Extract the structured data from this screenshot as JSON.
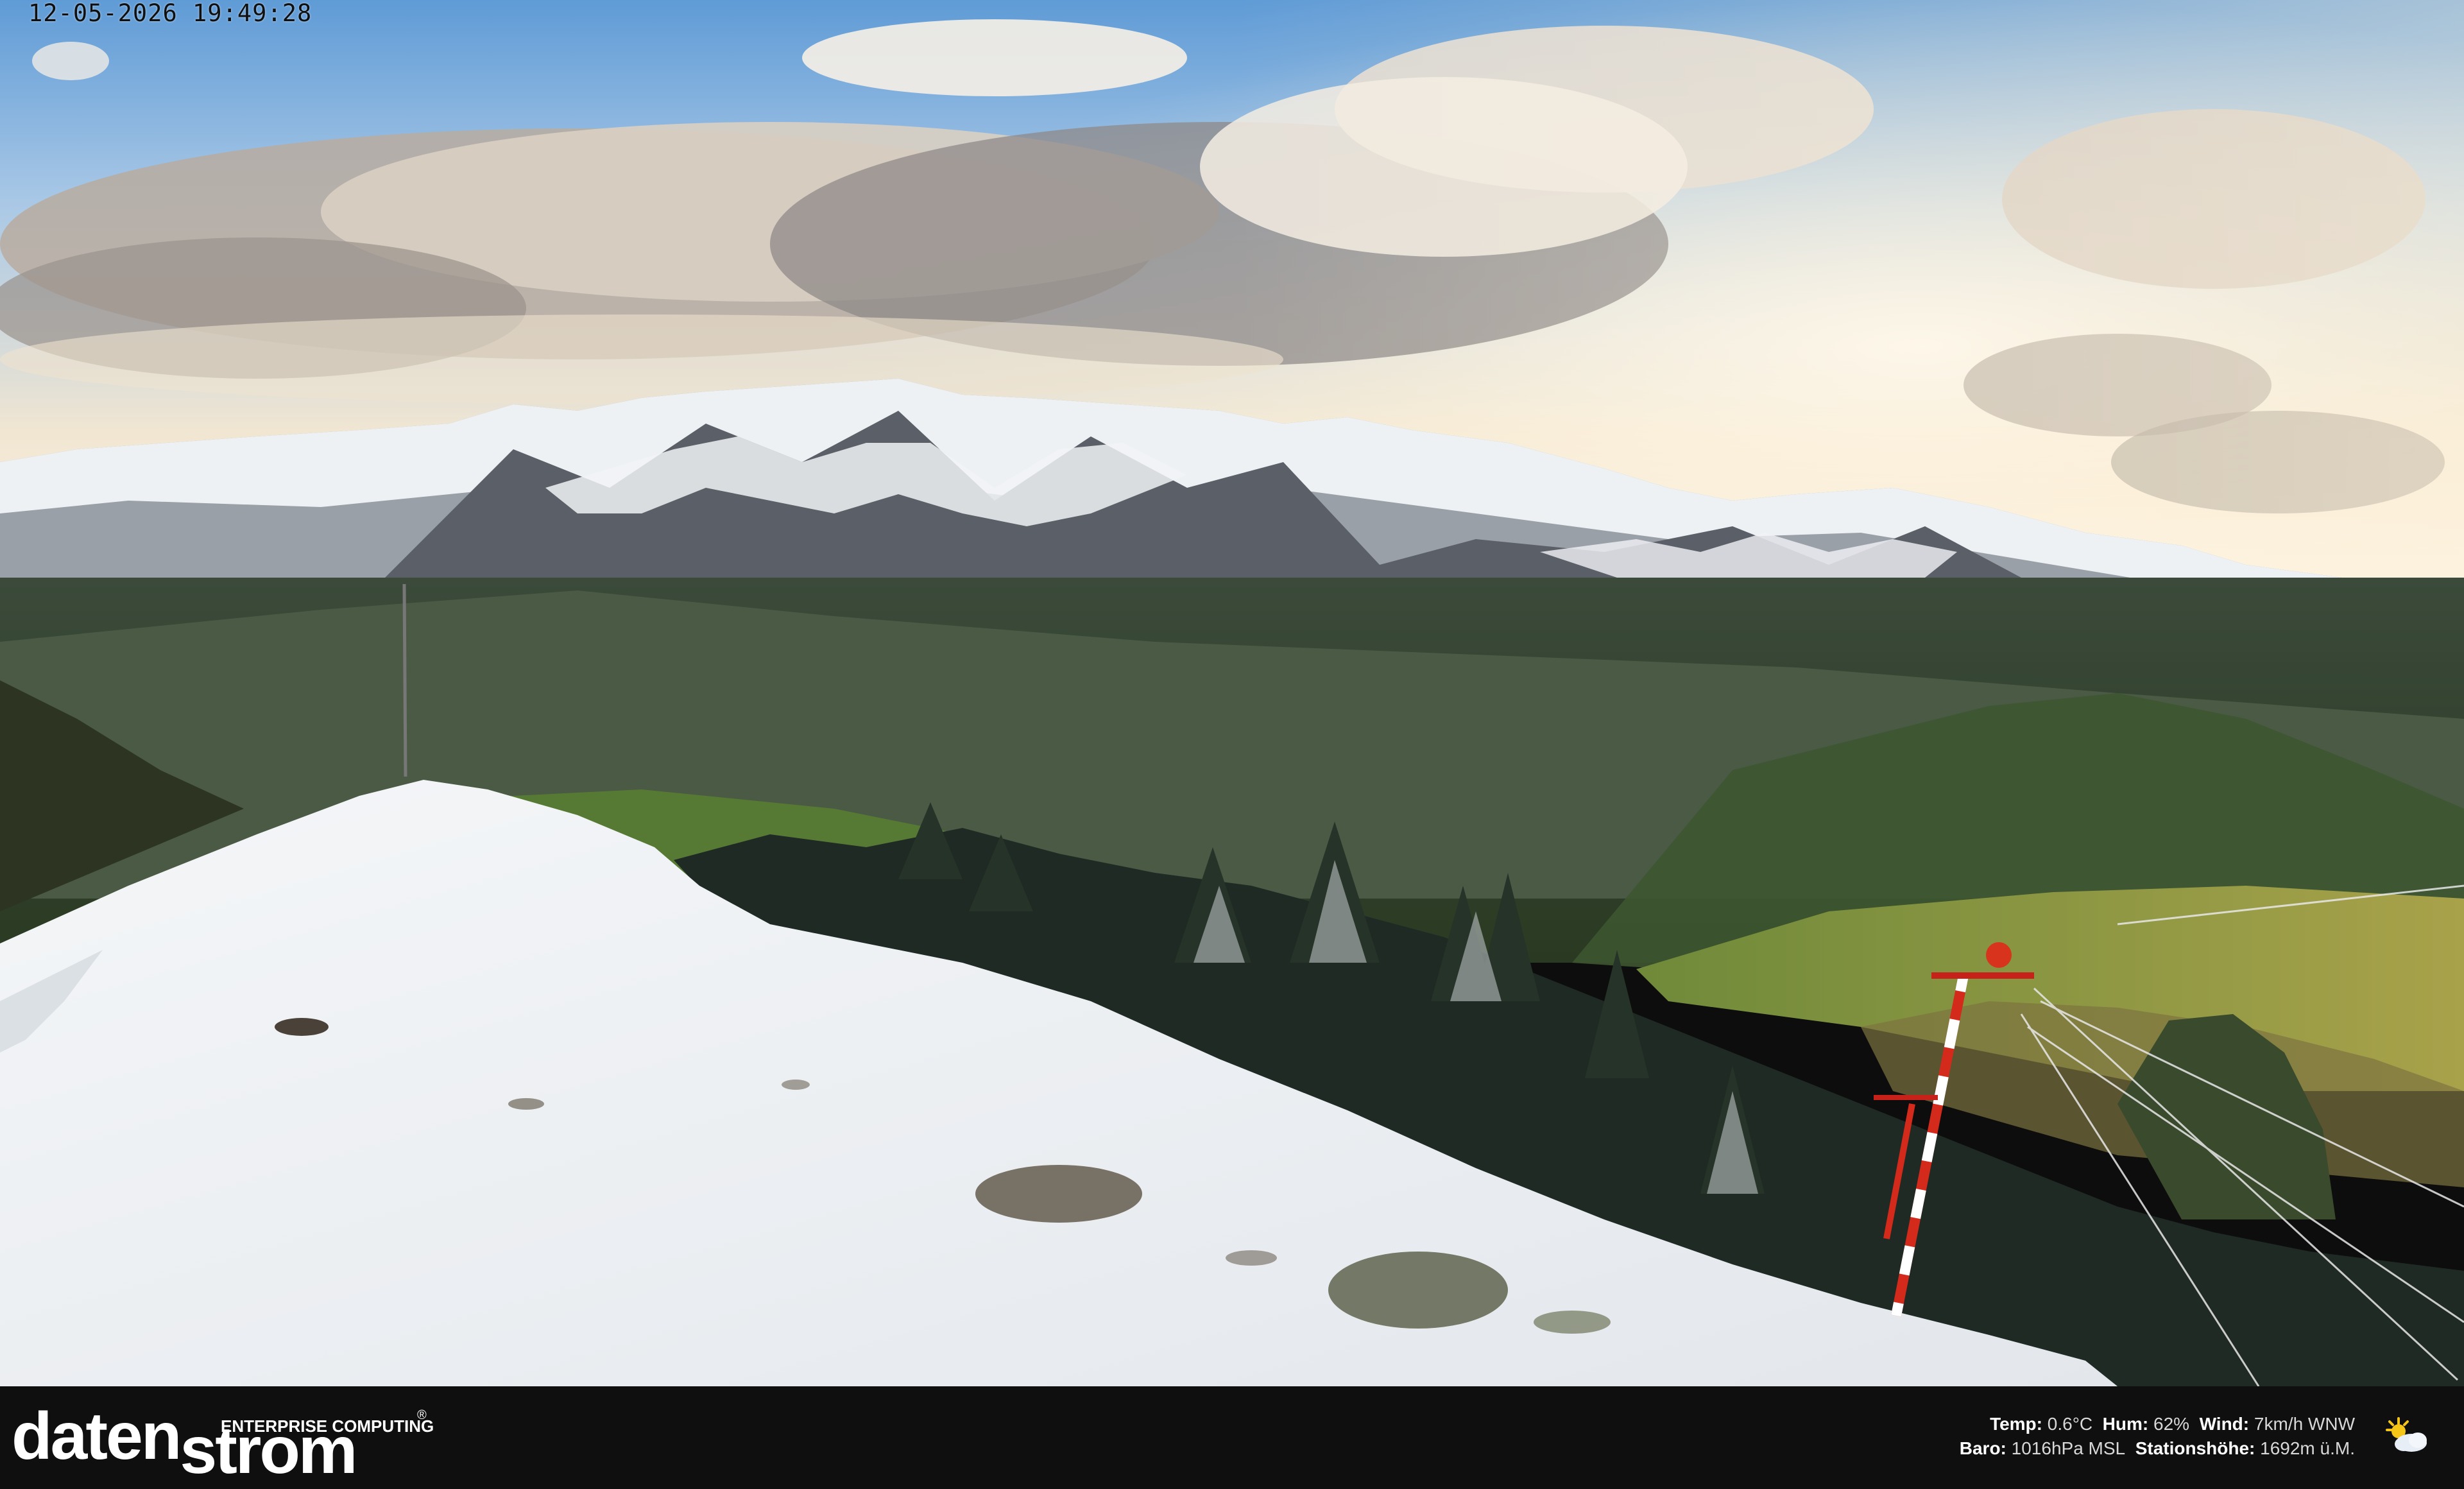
{
  "overlay": {
    "timestamp": "12-05-2026 19:49:28"
  },
  "branding": {
    "name_part1": "daten",
    "name_part2": "strom",
    "tagline": "ENTERPRISE COMPUTING",
    "registered_mark": "®"
  },
  "weather": {
    "temp_label": "Temp:",
    "temp_value": "0.6°C",
    "hum_label": "Hum:",
    "hum_value": "62%",
    "wind_label": "Wind:",
    "wind_value": "7km/h WNW",
    "baro_label": "Baro:",
    "baro_value": "1016hPa MSL",
    "elev_label": "Stationshöhe:",
    "elev_value": "1692m ü.M.",
    "icon": "partly-cloudy-icon"
  },
  "colors": {
    "sky_top": "#6aa2d8",
    "snow": "#f1f3f5",
    "footer_bg": "#0f0f10",
    "pole_red": "#d42a1c"
  }
}
